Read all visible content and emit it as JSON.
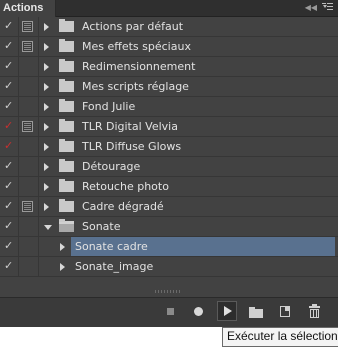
{
  "panel": {
    "tab_label": "Actions",
    "collapse_glyph": "◀◀"
  },
  "rows": [
    {
      "label": "Actions par défaut",
      "check": "✓",
      "red": false,
      "dialog": true,
      "arrow": "right",
      "type": "set"
    },
    {
      "label": "Mes effets spéciaux",
      "check": "✓",
      "red": false,
      "dialog": true,
      "arrow": "right",
      "type": "set"
    },
    {
      "label": "Redimensionnement",
      "check": "✓",
      "red": false,
      "dialog": false,
      "arrow": "right",
      "type": "set"
    },
    {
      "label": "Mes scripts réglage",
      "check": "✓",
      "red": false,
      "dialog": false,
      "arrow": "right",
      "type": "set"
    },
    {
      "label": "Fond Julie",
      "check": "✓",
      "red": false,
      "dialog": false,
      "arrow": "right",
      "type": "set"
    },
    {
      "label": "TLR Digital Velvia",
      "check": "✓",
      "red": true,
      "dialog": true,
      "arrow": "right",
      "type": "set"
    },
    {
      "label": "TLR Diffuse Glows",
      "check": "✓",
      "red": true,
      "dialog": false,
      "arrow": "right",
      "type": "set"
    },
    {
      "label": "Détourage",
      "check": "✓",
      "red": false,
      "dialog": false,
      "arrow": "right",
      "type": "set"
    },
    {
      "label": "Retouche photo",
      "check": "✓",
      "red": false,
      "dialog": false,
      "arrow": "right",
      "type": "set"
    },
    {
      "label": "Cadre dégradé",
      "check": "✓",
      "red": false,
      "dialog": true,
      "arrow": "right",
      "type": "set"
    },
    {
      "label": "Sonate",
      "check": "✓",
      "red": false,
      "dialog": false,
      "arrow": "down",
      "type": "set-open"
    },
    {
      "label": "Sonate cadre",
      "check": "✓",
      "red": false,
      "dialog": false,
      "arrow": "right",
      "type": "action",
      "selected": true
    },
    {
      "label": "Sonate_image",
      "check": "✓",
      "red": false,
      "dialog": false,
      "arrow": "right",
      "type": "action"
    }
  ],
  "toolbar": {
    "stop_icon": "stop-icon",
    "record_icon": "record-icon",
    "play_icon": "play-icon",
    "new_set_icon": "folder-icon",
    "new_action_icon": "new-action-icon",
    "delete_icon": "trash-icon"
  },
  "tooltip": {
    "text": "Exécuter la sélection"
  },
  "colors": {
    "panel": "#424242",
    "selection": "#59718f",
    "red_check": "#c83030"
  }
}
